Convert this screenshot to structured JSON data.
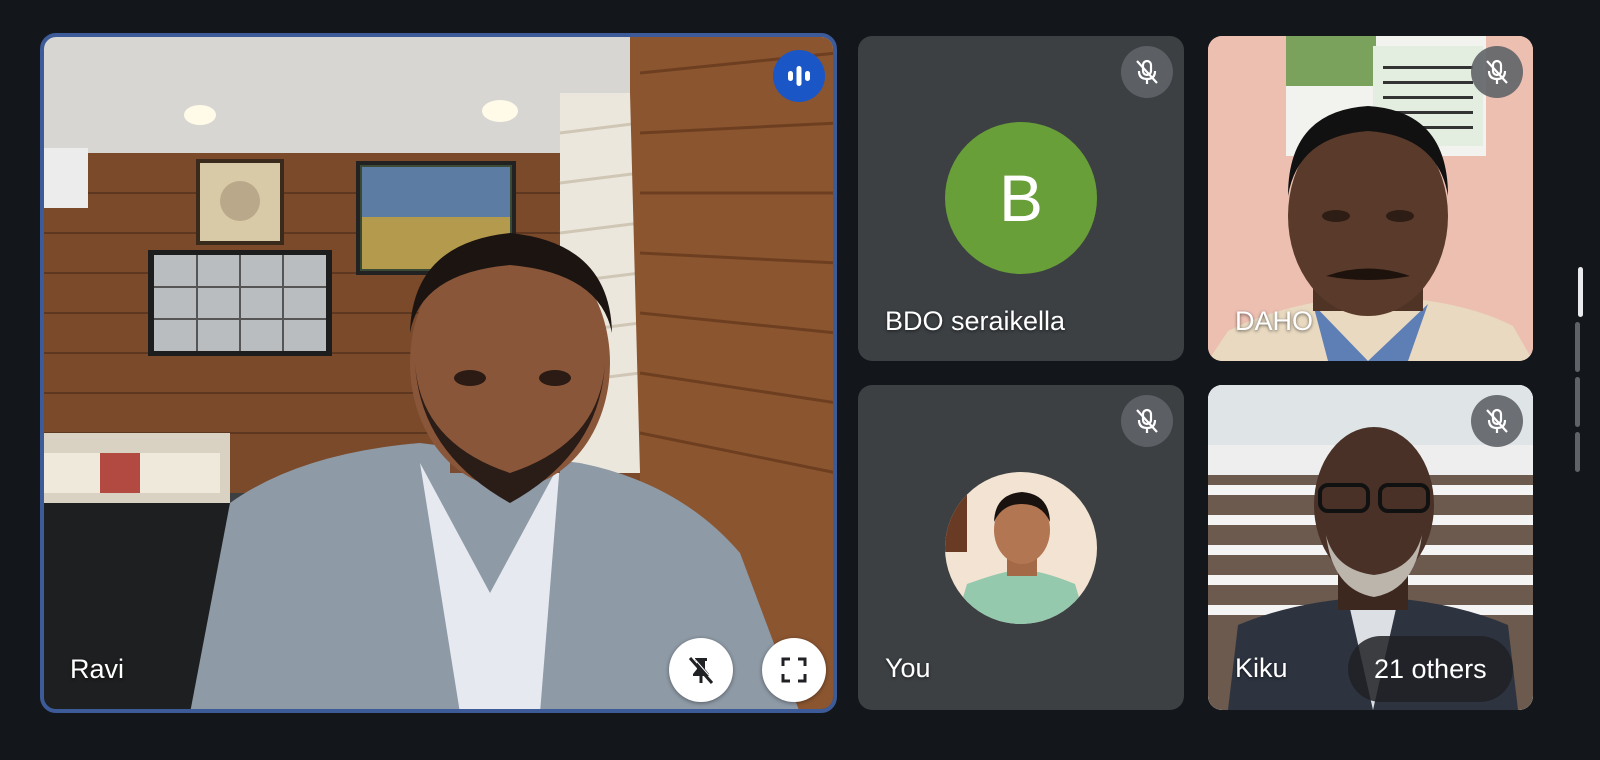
{
  "participants": {
    "featured": {
      "name": "Ravi"
    },
    "tile_bdo": {
      "name": "BDO seraikella",
      "avatar_letter": "B",
      "avatar_color": "#689f38"
    },
    "tile_daho": {
      "name": "DAHO"
    },
    "tile_you": {
      "name": "You"
    },
    "tile_kiku": {
      "name": "Kiku"
    }
  },
  "others_label": "21 others",
  "colors": {
    "background": "#13161b",
    "tile_bg": "#3c4043",
    "speaking_border": "#3d5a99",
    "audio_indicator": "#1a56c6"
  },
  "icons": {
    "mic_off": "mic-off-icon",
    "audio": "audio-level-icon",
    "unpin": "unpin-icon",
    "fullscreen": "fullscreen-icon"
  }
}
